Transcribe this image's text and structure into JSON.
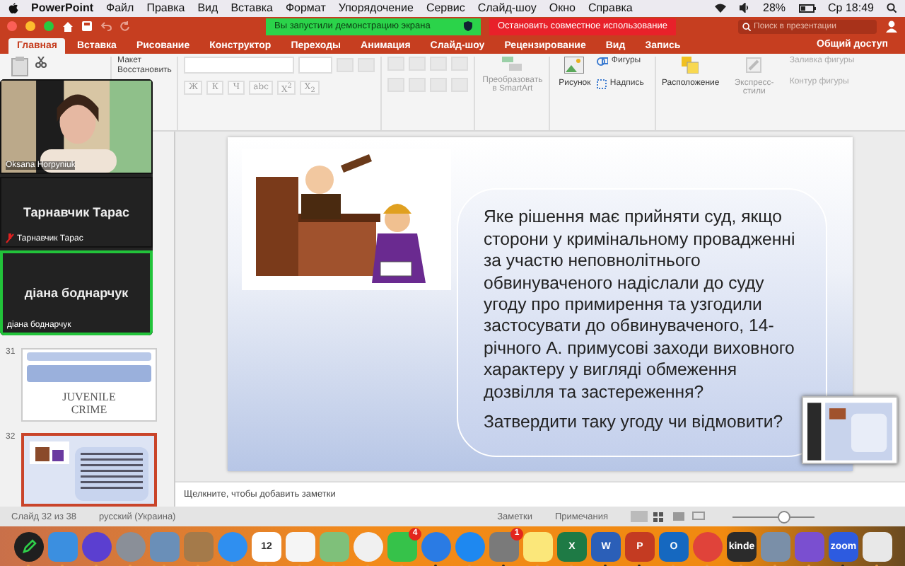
{
  "menubar": {
    "app": "PowerPoint",
    "menus": [
      "Файл",
      "Правка",
      "Вид",
      "Вставка",
      "Формат",
      "Упорядочение",
      "Сервис",
      "Слайд-шоу",
      "Окно",
      "Справка"
    ],
    "battery": "28%",
    "clock": "Ср 18:49"
  },
  "titlebar": {
    "share_banner": "Вы запустили демонстрацию экрана",
    "stop_button": "Остановить совместное использование",
    "search": {
      "placeholder": "Поиск в презентации"
    }
  },
  "tabs": [
    {
      "label": "Главная",
      "selected": true
    },
    {
      "label": "Вставка",
      "selected": false
    },
    {
      "label": "Рисование",
      "selected": false
    },
    {
      "label": "Конструктор",
      "selected": false
    },
    {
      "label": "Переходы",
      "selected": false
    },
    {
      "label": "Анимация",
      "selected": false
    },
    {
      "label": "Слайд-шоу",
      "selected": false
    },
    {
      "label": "Рецензирование",
      "selected": false
    },
    {
      "label": "Вид",
      "selected": false
    },
    {
      "label": "Запись",
      "selected": false
    }
  ],
  "share_button": "Общий доступ",
  "ribbon": {
    "layout": "Макет",
    "reset": "Восстановить",
    "format_buttons": [
      "Ж",
      "К",
      "Ч",
      "abc",
      "X$^{2}$",
      "X$_{2}$"
    ],
    "smartart": "Преобразовать в SmartArt",
    "picture": "Рисунок",
    "shapes": "Фигуры",
    "textbox": "Надпись",
    "arrange": "Расположение",
    "quick_styles": "Экспресс-стили",
    "shape_fill": "Заливка фигуры",
    "shape_outline": "Контур фигуры"
  },
  "participants": [
    {
      "kind": "video",
      "label": "Oksana Horpyniuk",
      "muted": false,
      "active": false
    },
    {
      "kind": "name",
      "name": "Тарнавчик Тарас",
      "label": "Тарнавчик Тарас",
      "muted": true,
      "active": false
    },
    {
      "kind": "name",
      "name": "діана боднарчук",
      "label": "діана боднарчук",
      "muted": false,
      "active": true
    }
  ],
  "slides": [
    {
      "number": "31",
      "kind": "juvenile",
      "selected": false,
      "words": [
        "JUVENILE",
        "CRIME"
      ]
    },
    {
      "number": "32",
      "kind": "question",
      "selected": true
    }
  ],
  "slide": {
    "paragraphs": [
      "Яке рішення має прийняти суд, якщо сторони у кримінальному провадженні за участю неповнолітнього обвинуваченого надіслали до суду угоду про примирення та узгодили застосувати до  обвинуваченого, 14-річного А. примусові заходи виховного характеру у вигляді обмеження дозвілля та застереження?",
      "Затвердити таку угоду чи відмовити?"
    ]
  },
  "notes": {
    "placeholder": "Щелкните, чтобы добавить заметки"
  },
  "status_bar": {
    "slide_counter": "Слайд 32 из 38",
    "language": "русский (Украина)",
    "notes": "Заметки",
    "comments": "Примечания",
    "zoom": {
      "level": 0.62
    }
  },
  "dock": [
    {
      "kind": "pen",
      "color": "#1f1f1f",
      "running": false
    },
    {
      "kind": "tile",
      "color": "#3b8fe0",
      "running": false
    },
    {
      "kind": "orb",
      "color": "#5b3fd0",
      "running": false
    },
    {
      "kind": "orb",
      "color": "#8a8f98",
      "running": false
    },
    {
      "kind": "tile",
      "color": "#6a8fb8",
      "running": false
    },
    {
      "kind": "tile",
      "color": "#a47a4a",
      "running": false
    },
    {
      "kind": "orb",
      "color": "#2f8ff0",
      "running": false
    },
    {
      "kind": "tile",
      "color": "#ffffff",
      "glyph": "12",
      "running": false
    },
    {
      "kind": "tile",
      "color": "#f5f5f5",
      "running": false
    },
    {
      "kind": "tile",
      "color": "#7fc07a",
      "running": false
    },
    {
      "kind": "orb",
      "color": "#f0f0f0",
      "running": false
    },
    {
      "kind": "tile",
      "color": "#36c24a",
      "badge": "4",
      "running": false
    },
    {
      "kind": "orb",
      "color": "#2a7be4",
      "running": true
    },
    {
      "kind": "orb",
      "color": "#1e88f0",
      "running": false
    },
    {
      "kind": "tile",
      "color": "#7a7a7a",
      "badge": "1",
      "running": true
    },
    {
      "kind": "tile",
      "color": "#fbe77a",
      "running": false
    },
    {
      "kind": "tile",
      "color": "#1e7a45",
      "glyph": "X",
      "running": false
    },
    {
      "kind": "tile",
      "color": "#2b5fb8",
      "glyph": "W",
      "running": true
    },
    {
      "kind": "tile",
      "color": "#c43b22",
      "glyph": "P",
      "running": true
    },
    {
      "kind": "tile",
      "color": "#1568c0",
      "glyph": "O",
      "running": false
    },
    {
      "kind": "orb",
      "color": "#e0433a",
      "running": false
    },
    {
      "kind": "tile",
      "color": "#2b2b2b",
      "glyph": "kinde",
      "running": false
    },
    {
      "kind": "tile",
      "color": "#7a8fa8",
      "running": false
    },
    {
      "kind": "tile",
      "color": "#7a4fd0",
      "running": false
    },
    {
      "kind": "tile",
      "color": "#2d5be0",
      "glyph": "zoom",
      "running": true
    },
    {
      "kind": "tile",
      "color": "#e8e8e8",
      "running": false
    }
  ]
}
